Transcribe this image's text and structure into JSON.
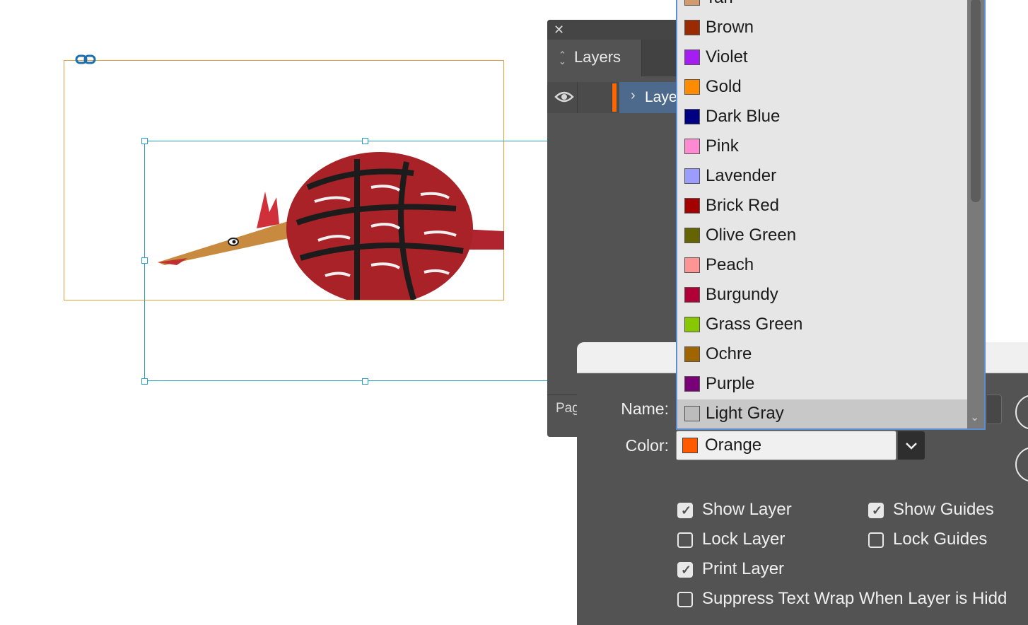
{
  "canvas": {
    "link_icon": "link-icon",
    "artwork": "painted-bird-figurine"
  },
  "layers_panel": {
    "close_glyph": "✕",
    "tab_label": "Layers",
    "tab_icon": "up-down-arrows-icon",
    "layer": {
      "name": "Laye",
      "visible_icon": "eye-icon",
      "expand_icon": "chevron-right-icon",
      "color": "#ff6600"
    },
    "footer_label": "Pag"
  },
  "dialog": {
    "name_label": "Name:",
    "color_label": "Color:",
    "color_value": "Orange",
    "color_swatch": "#ff5a00",
    "checkboxes_left": [
      {
        "label": "Show Layer",
        "checked": true
      },
      {
        "label": "Lock Layer",
        "checked": false
      },
      {
        "label": "Print Layer",
        "checked": true
      },
      {
        "label": "Suppress Text Wrap When Layer is Hidd",
        "checked": false
      }
    ],
    "checkboxes_right": [
      {
        "label": "Show Guides",
        "checked": true
      },
      {
        "label": "Lock Guides",
        "checked": false
      }
    ]
  },
  "color_dropdown": {
    "items": [
      {
        "label": "Tan",
        "color": "#d29b6e"
      },
      {
        "label": "Brown",
        "color": "#9a2b00"
      },
      {
        "label": "Violet",
        "color": "#a61df2"
      },
      {
        "label": "Gold",
        "color": "#ff8c00"
      },
      {
        "label": "Dark Blue",
        "color": "#000082"
      },
      {
        "label": "Pink",
        "color": "#ff8ad2"
      },
      {
        "label": "Lavender",
        "color": "#9c9cff"
      },
      {
        "label": "Brick Red",
        "color": "#a50000"
      },
      {
        "label": "Olive Green",
        "color": "#646400"
      },
      {
        "label": "Peach",
        "color": "#ff9494"
      },
      {
        "label": "Burgundy",
        "color": "#b10037"
      },
      {
        "label": "Grass Green",
        "color": "#88c800"
      },
      {
        "label": "Ochre",
        "color": "#a06400"
      },
      {
        "label": "Purple",
        "color": "#7a0078"
      },
      {
        "label": "Light Gray",
        "color": "#bcbcbc"
      }
    ],
    "selected": "Light Gray"
  }
}
